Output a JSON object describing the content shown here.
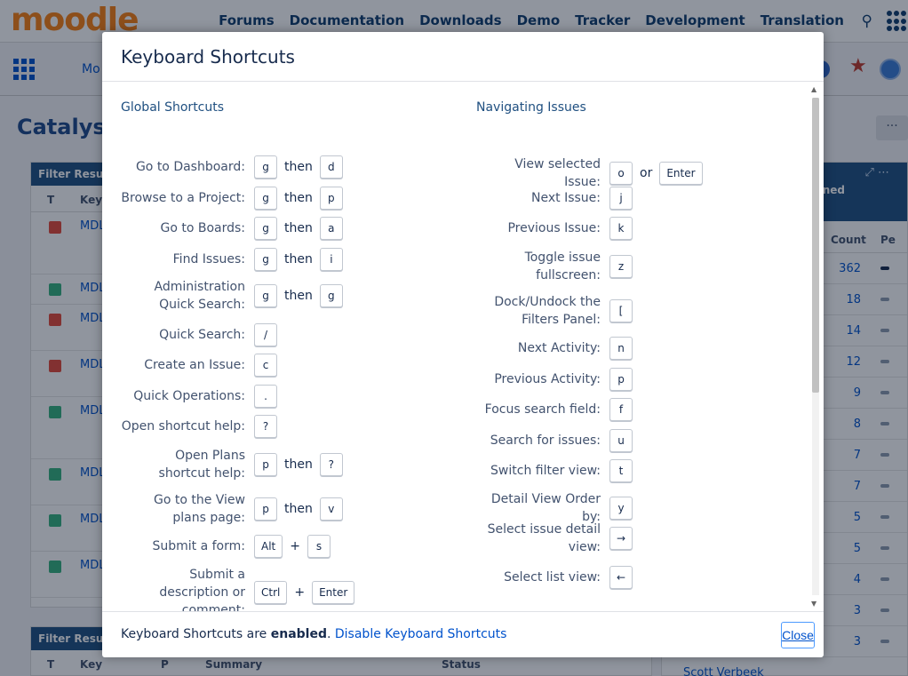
{
  "background": {
    "logo": "moodle",
    "topnav": [
      "Forums",
      "Documentation",
      "Downloads",
      "Demo",
      "Tracker",
      "Development",
      "Translation"
    ],
    "jira_module_partial": "Mo",
    "page_title": "Catalyst",
    "more": "···",
    "filter_panel_title": "Filter Results",
    "filter_cols": [
      "T",
      "Key"
    ],
    "filter_panel2_cols": [
      "T",
      "Key",
      "P",
      "Summary",
      "Status"
    ],
    "issue_rows": [
      {
        "type": "bug",
        "key": "MDL",
        "height": 70
      },
      {
        "type": "improvement",
        "key": "MDL",
        "height": 34
      },
      {
        "type": "bug",
        "key": "MDL",
        "height": 52
      },
      {
        "type": "bug",
        "key": "MDL",
        "height": 52
      },
      {
        "type": "improvement",
        "key": "MDL",
        "height": 70
      },
      {
        "type": "improvement",
        "key": "MDL",
        "height": 52
      },
      {
        "type": "improvement",
        "key": "MDL",
        "height": 52
      },
      {
        "type": "improvement",
        "key": "MDL",
        "height": 52
      }
    ],
    "right_panel_head_partial": "gned",
    "right_cols": [
      "Count",
      "Pe"
    ],
    "right_counts": [
      "362",
      "18",
      "14",
      "12",
      "9",
      "8",
      "7",
      "7",
      "5",
      "5",
      "4",
      "3",
      "3"
    ],
    "right_last_name_partial": "Scott Verbeek"
  },
  "dialog": {
    "title": "Keyboard Shortcuts",
    "global": {
      "title": "Global Shortcuts",
      "items": [
        {
          "label": "Go to Dashboard:",
          "keys": [
            "g",
            "d"
          ],
          "joiner": "then"
        },
        {
          "label": "Browse to a Project:",
          "keys": [
            "g",
            "p"
          ],
          "joiner": "then"
        },
        {
          "label": "Go to Boards:",
          "keys": [
            "g",
            "a"
          ],
          "joiner": "then"
        },
        {
          "label": "Find Issues:",
          "keys": [
            "g",
            "i"
          ],
          "joiner": "then"
        },
        {
          "label": "Administration Quick Search:",
          "keys": [
            "g",
            "g"
          ],
          "joiner": "then"
        },
        {
          "label": "Quick Search:",
          "keys": [
            "/"
          ],
          "joiner": ""
        },
        {
          "label": "Create an Issue:",
          "keys": [
            "c"
          ],
          "joiner": ""
        },
        {
          "label": "Quick Operations:",
          "keys": [
            "."
          ],
          "joiner": ""
        },
        {
          "label": "Open shortcut help:",
          "keys": [
            "?"
          ],
          "joiner": ""
        },
        {
          "label": "Open Plans shortcut help:",
          "keys": [
            "p",
            "?"
          ],
          "joiner": "then"
        },
        {
          "label": "Go to the View plans page:",
          "keys": [
            "p",
            "v"
          ],
          "joiner": "then"
        },
        {
          "label": "Submit a form:",
          "keys": [
            "Alt",
            "s"
          ],
          "joiner": "+"
        },
        {
          "label": "Submit a description or comment:",
          "keys": [
            "Ctrl",
            "Enter"
          ],
          "joiner": "+"
        }
      ]
    },
    "navigating": {
      "title": "Navigating Issues",
      "items": [
        {
          "label": "View selected Issue:",
          "keys": [
            "o",
            "Enter"
          ],
          "joiner": "or"
        },
        {
          "label": "Next Issue:",
          "keys": [
            "j"
          ],
          "joiner": ""
        },
        {
          "label": "Previous Issue:",
          "keys": [
            "k"
          ],
          "joiner": ""
        },
        {
          "label": "Toggle issue fullscreen:",
          "keys": [
            "z"
          ],
          "joiner": ""
        },
        {
          "label": "Dock/Undock the Filters Panel:",
          "keys": [
            "["
          ],
          "joiner": ""
        },
        {
          "label": "Next Activity:",
          "keys": [
            "n"
          ],
          "joiner": ""
        },
        {
          "label": "Previous Activity:",
          "keys": [
            "p"
          ],
          "joiner": ""
        },
        {
          "label": "Focus search field:",
          "keys": [
            "f"
          ],
          "joiner": ""
        },
        {
          "label": "Search for issues:",
          "keys": [
            "u"
          ],
          "joiner": ""
        },
        {
          "label": "Switch filter view:",
          "keys": [
            "t"
          ],
          "joiner": ""
        },
        {
          "label": "Detail View Order by:",
          "keys": [
            "y"
          ],
          "joiner": ""
        },
        {
          "label": "Select issue detail view:",
          "keys": [
            "→"
          ],
          "joiner": ""
        },
        {
          "label": "Select list view:",
          "keys": [
            "←"
          ],
          "joiner": ""
        }
      ]
    },
    "footer": {
      "prefix": "Keyboard Shortcuts are ",
      "status": "enabled",
      "suffix": ". ",
      "disable_link": "Disable Keyboard Shortcuts",
      "close": "Close"
    }
  }
}
